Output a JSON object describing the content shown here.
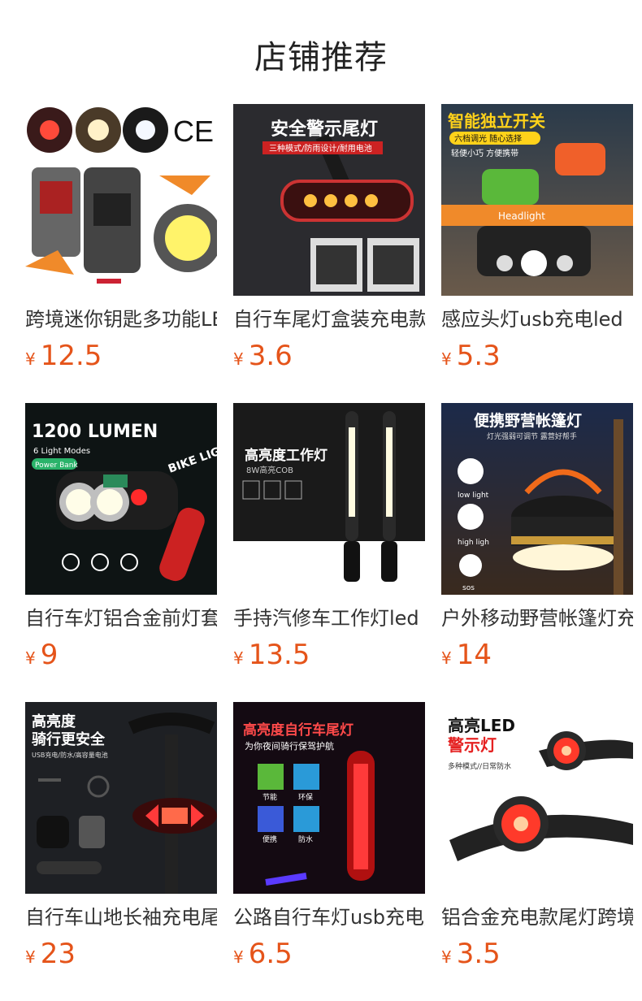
{
  "page": {
    "title": "店铺推荐"
  },
  "products": [
    {
      "name": "跨境迷你钥匙多功能LED手电筒",
      "currency": "¥",
      "price": "12.5",
      "banner": "",
      "sub": "",
      "badge": "CE"
    },
    {
      "name": "自行车尾灯盒装充电款",
      "currency": "¥",
      "price": "3.6",
      "banner": "安全警示尾灯",
      "sub": "三种模式/防雨设计/耐用电池",
      "badge": ""
    },
    {
      "name": "感应头灯usb充电led",
      "currency": "¥",
      "price": "5.3",
      "banner": "智能独立开关",
      "sub": "六档调光 随心选择",
      "sub2": "轻便小巧 方便携带",
      "badge": "Headlight"
    },
    {
      "name": "自行车灯铝合金前灯套装",
      "currency": "¥",
      "price": "9",
      "banner": "1200 LUMEN",
      "sub": "6 Light Modes",
      "sub2": "Power Bank",
      "badge": "BIKE LIGHT"
    },
    {
      "name": "手持汽修车工作灯led",
      "currency": "¥",
      "price": "13.5",
      "banner": "高亮度工作灯",
      "sub": "8W高亮COB",
      "badge": ""
    },
    {
      "name": "户外移动野营帐篷灯充电",
      "currency": "¥",
      "price": "14",
      "banner": "便携野营帐篷灯",
      "sub": "灯光强弱可调节 露营好帮手",
      "modes": [
        "low light",
        "high ligh",
        "sos"
      ]
    },
    {
      "name": "自行车山地长袖充电尾灯",
      "currency": "¥",
      "price": "23",
      "banner": "高亮度",
      "sub": "骑行更安全",
      "sub2": "USB充电/防水/高容量电池"
    },
    {
      "name": "公路自行车灯usb充电尾灯",
      "currency": "¥",
      "price": "6.5",
      "banner": "高亮度自行车尾灯",
      "sub": "为你夜间骑行保驾护航",
      "features": [
        "节能",
        "环保",
        "便携",
        "防水"
      ]
    },
    {
      "name": "铝合金充电款尾灯跨境",
      "currency": "¥",
      "price": "3.5",
      "banner": "高亮LED",
      "sub": "警示灯",
      "sub2": "多种模式//日常防水"
    }
  ],
  "colors": {
    "price": "#e5541a",
    "text": "#333333",
    "title": "#222222"
  }
}
